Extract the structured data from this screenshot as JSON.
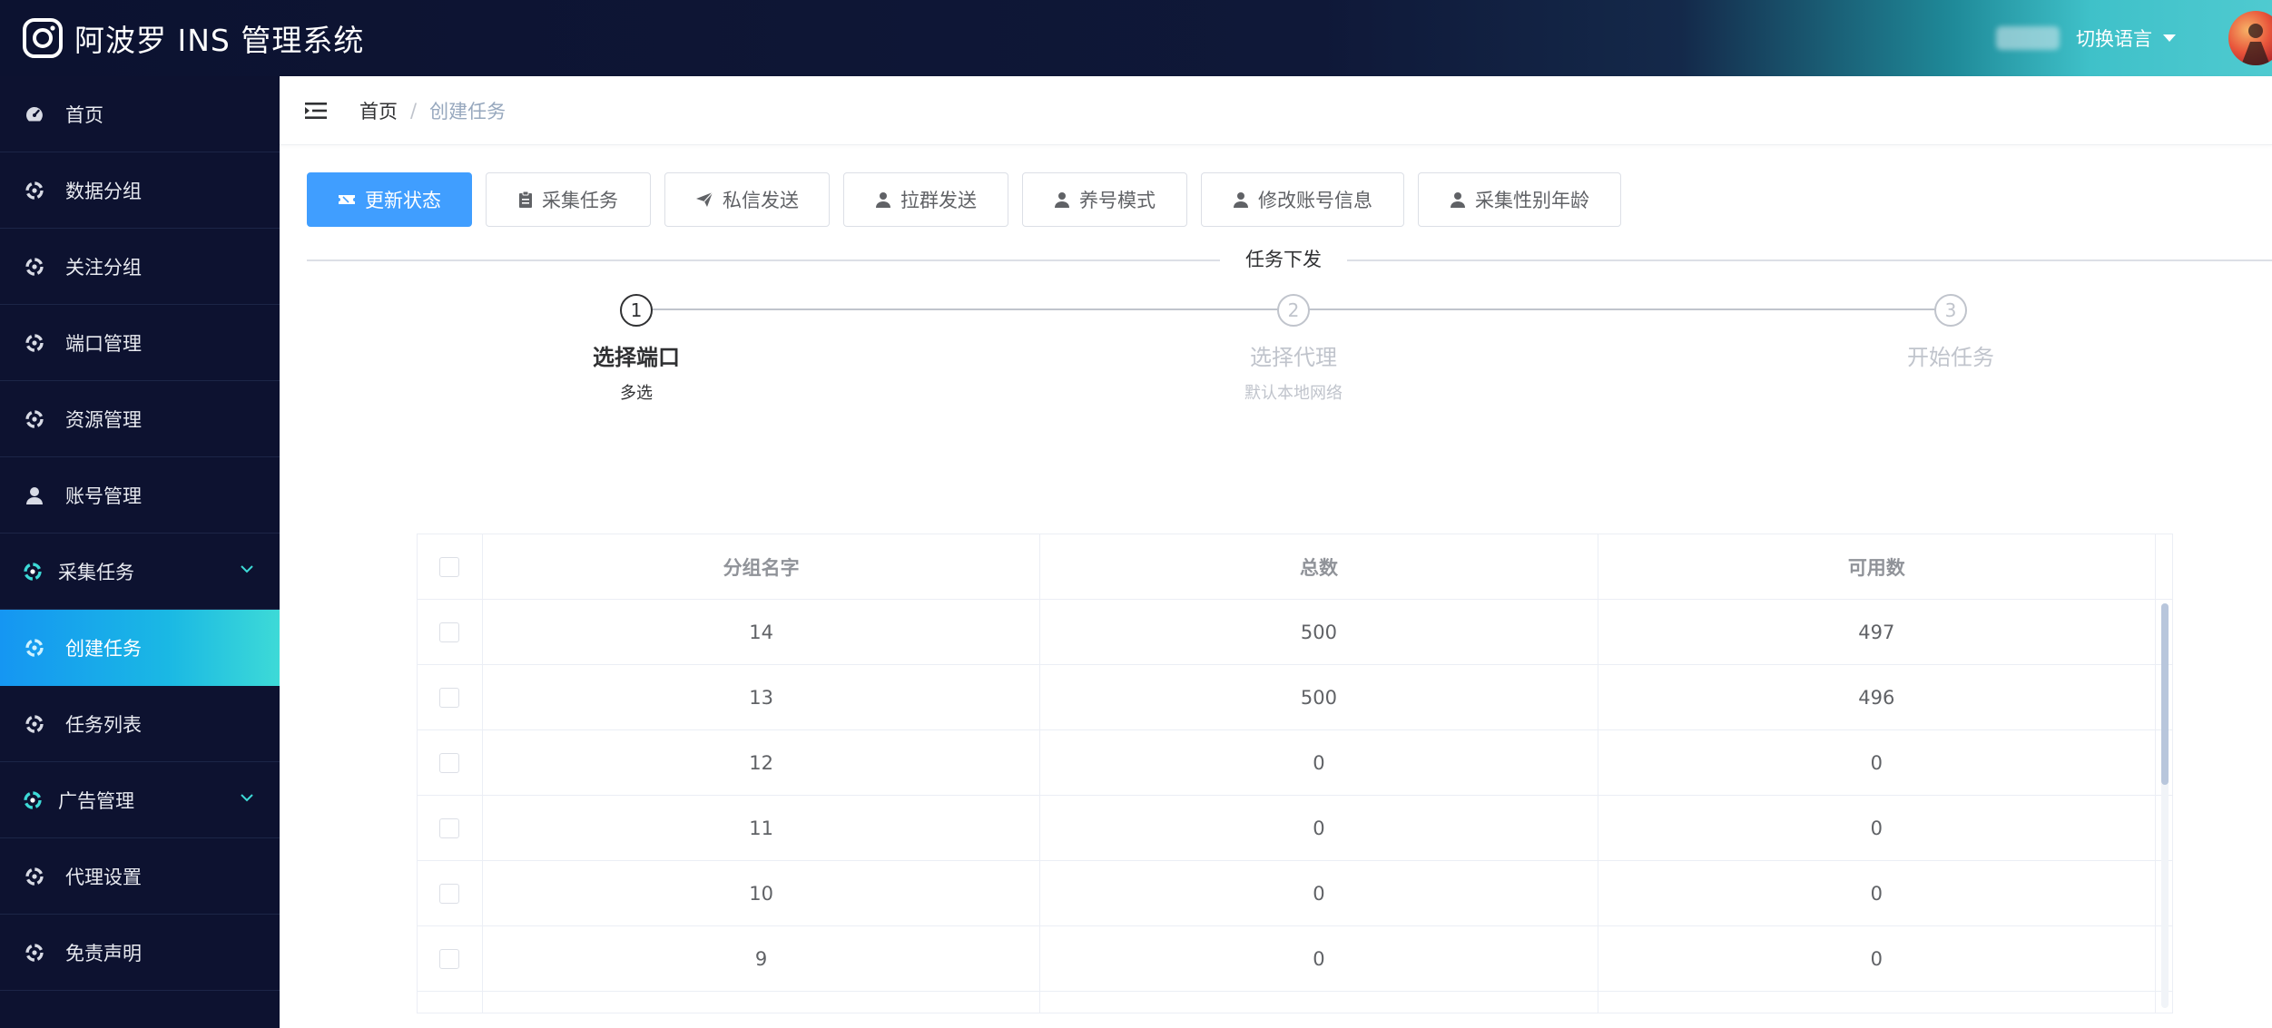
{
  "header": {
    "app_title": "阿波罗 INS 管理系统",
    "lang_switch": "切换语言"
  },
  "sidebar": {
    "items": [
      {
        "label": "首页",
        "icon": "dashboard-icon"
      },
      {
        "label": "数据分组",
        "icon": "gear-icon"
      },
      {
        "label": "关注分组",
        "icon": "gear-icon"
      },
      {
        "label": "端口管理",
        "icon": "gear-icon"
      },
      {
        "label": "资源管理",
        "icon": "gear-icon"
      },
      {
        "label": "账号管理",
        "icon": "user-icon"
      },
      {
        "label": "采集任务",
        "icon": "gear-icon"
      },
      {
        "label": "创建任务",
        "icon": "gear-icon"
      },
      {
        "label": "任务列表",
        "icon": "gear-icon"
      },
      {
        "label": "广告管理",
        "icon": "gear-icon"
      },
      {
        "label": "代理设置",
        "icon": "gear-icon"
      },
      {
        "label": "免责声明",
        "icon": "gear-icon"
      }
    ]
  },
  "breadcrumb": {
    "home": "首页",
    "separator": "/",
    "current": "创建任务"
  },
  "toolbar": {
    "buttons": [
      {
        "label": "更新状态",
        "icon": "ticket-icon"
      },
      {
        "label": "采集任务",
        "icon": "clipboard-icon"
      },
      {
        "label": "私信发送",
        "icon": "send-icon"
      },
      {
        "label": "拉群发送",
        "icon": "user-icon"
      },
      {
        "label": "养号模式",
        "icon": "user-icon"
      },
      {
        "label": "修改账号信息",
        "icon": "user-icon"
      },
      {
        "label": "采集性别年龄",
        "icon": "user-icon"
      }
    ]
  },
  "section_title": "任务下发",
  "steps": [
    {
      "number": "1",
      "title": "选择端口",
      "desc": "多选"
    },
    {
      "number": "2",
      "title": "选择代理",
      "desc": "默认本地网络"
    },
    {
      "number": "3",
      "title": "开始任务",
      "desc": ""
    }
  ],
  "table": {
    "columns": [
      "分组名字",
      "总数",
      "可用数"
    ],
    "rows": [
      [
        "14",
        "500",
        "497"
      ],
      [
        "13",
        "500",
        "496"
      ],
      [
        "12",
        "0",
        "0"
      ],
      [
        "11",
        "0",
        "0"
      ],
      [
        "10",
        "0",
        "0"
      ],
      [
        "9",
        "0",
        "0"
      ]
    ]
  },
  "colors": {
    "header_bg": "#0c1230",
    "sidebar_bg": "#0d1230",
    "primary": "#409eff",
    "active_gradient_end": "#3ddad7",
    "step_active": "#303133",
    "step_inactive": "#c0c4cc"
  }
}
